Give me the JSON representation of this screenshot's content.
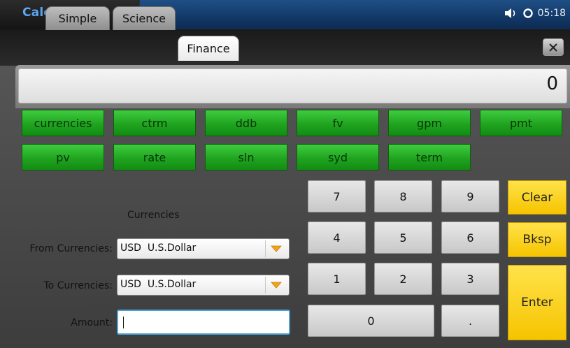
{
  "app": {
    "title": "Calculator",
    "clock": "05:18",
    "icons": [
      "speaker-icon",
      "sync-icon"
    ]
  },
  "tabs": [
    {
      "label": "Simple",
      "active": false
    },
    {
      "label": "Science",
      "active": false
    },
    {
      "label": "Finance",
      "active": true
    }
  ],
  "display": {
    "value": "0"
  },
  "functions": [
    "currencies",
    "ctrm",
    "ddb",
    "fv",
    "gpm",
    "pmt",
    "pv",
    "rate",
    "sln",
    "syd",
    "term"
  ],
  "form": {
    "heading": "Currencies",
    "from_label": "From Currencies:",
    "from_value": "USD  U.S.Dollar",
    "to_label": "To Currencies:",
    "to_value": "USD  U.S.Dollar",
    "amount_label": "Amount:",
    "amount_value": ""
  },
  "keypad": {
    "digits": [
      "7",
      "8",
      "9",
      "4",
      "5",
      "6",
      "1",
      "2",
      "3",
      "0",
      "."
    ],
    "clear": "Clear",
    "bksp": "Bksp",
    "enter": "Enter"
  },
  "colors": {
    "function_green": "#22a722",
    "action_yellow": "#f8cf10",
    "title_blue": "#5aa7f0"
  }
}
